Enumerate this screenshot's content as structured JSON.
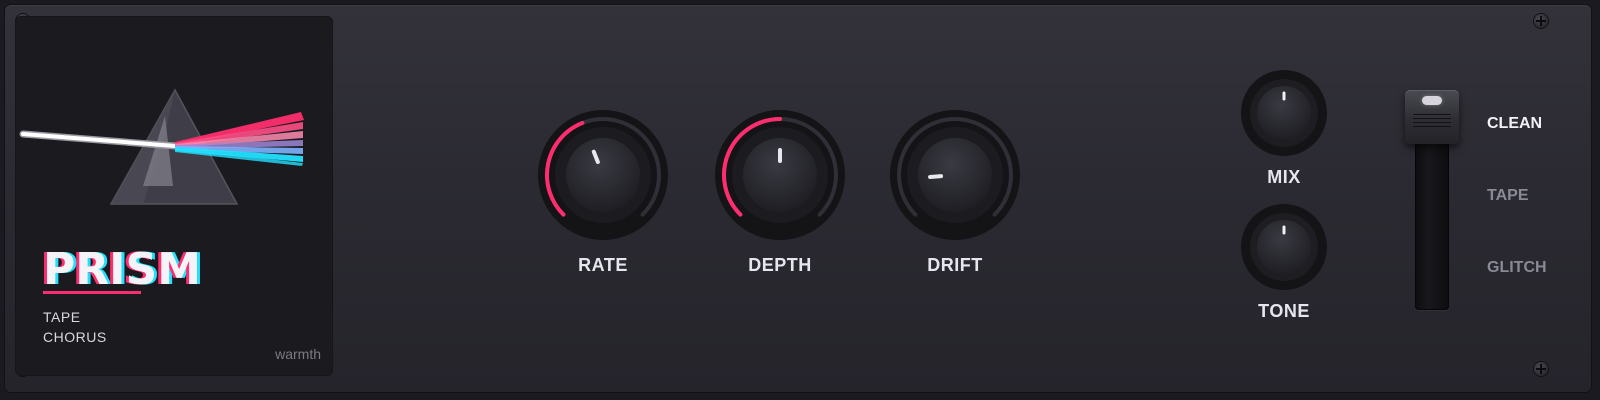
{
  "plugin": {
    "name": "PRISM",
    "subtitle_line1": "TAPE",
    "subtitle_line2": "CHORUS",
    "tag": "warmth",
    "accent_color": "#ff2d6f",
    "cyan_color": "#22e0ff"
  },
  "knobs": {
    "rate": {
      "label": "RATE",
      "value": 0.42
    },
    "depth": {
      "label": "DEPTH",
      "value": 0.5
    },
    "drift": {
      "label": "DRIFT",
      "value": 0.15
    },
    "mix": {
      "label": "MIX",
      "value": 0.5
    },
    "tone": {
      "label": "TONE",
      "value": 0.5
    }
  },
  "mode_switch": {
    "options": [
      "CLEAN",
      "TAPE",
      "GLITCH"
    ],
    "selected": "CLEAN",
    "active_color": "#f2f2f6",
    "inactive_color": "#8a8a96"
  }
}
